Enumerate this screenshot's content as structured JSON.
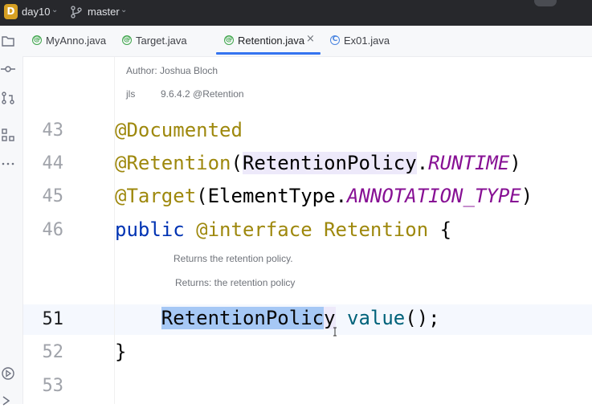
{
  "titlebar": {
    "project_badge": "D",
    "project_name": "day10",
    "branch": "master"
  },
  "tabs": [
    {
      "label": "MyAnno.java",
      "icon": "annotation-icon",
      "active": false
    },
    {
      "label": "Target.java",
      "icon": "annotation-icon",
      "active": false
    },
    {
      "label": "Retention.java",
      "icon": "annotation-icon",
      "active": true,
      "close": "×"
    },
    {
      "label": "Ex01.java",
      "icon": "class-icon",
      "active": false
    }
  ],
  "doc_header": {
    "author": "Author: Joshua Bloch",
    "jls_label": "jls",
    "jls_value": "9.6.4.2 @Retention"
  },
  "code_lines": {
    "l43": {
      "num": "43",
      "anno": "@Documented"
    },
    "l44": {
      "num": "44",
      "anno": "@Retention",
      "open": "(",
      "cls": "RetentionPolicy",
      "dot": ".",
      "const": "RUNTIME",
      "close": ")"
    },
    "l45": {
      "num": "45",
      "anno": "@Target",
      "open": "(",
      "cls": "ElementType",
      "dot": ".",
      "const": "ANNOTATION_TYPE",
      "close": ")"
    },
    "l46": {
      "num": "46",
      "kw": "public",
      "iface": "@interface",
      "name": "Retention",
      "brace": "{"
    },
    "l51": {
      "num": "51",
      "type_sel": "RetentionPolic",
      "type_rest": "y",
      "method": "value",
      "tail": "();"
    },
    "l52": {
      "num": "52",
      "brace": "}"
    },
    "l53": {
      "num": "53"
    }
  },
  "inline_doc": {
    "summary": "Returns the retention policy.",
    "returns": "Returns: the retention policy"
  },
  "colors": {
    "annotation": "#9e880d",
    "keyword": "#0033b3",
    "constant": "#871094",
    "method": "#00627a",
    "selection": "#a6c8f5",
    "tab_underline": "#3574f0"
  }
}
